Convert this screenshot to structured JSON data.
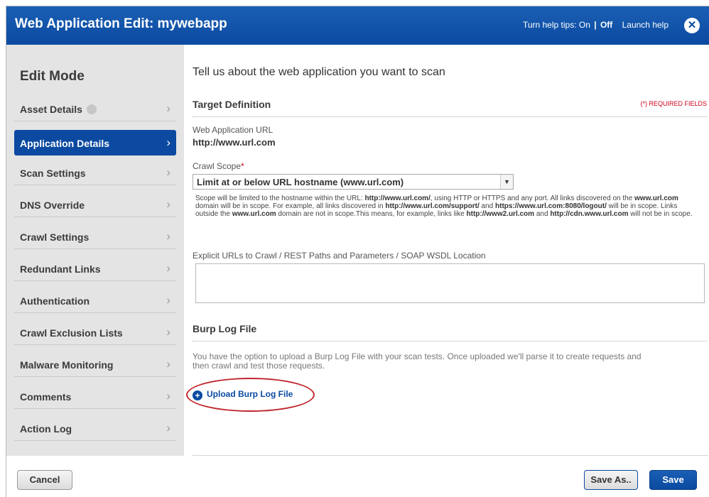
{
  "window": {
    "title": "Web Application Edit: mywebapp",
    "help_prefix": "Turn help tips:",
    "help_on": "On",
    "help_sep": "|",
    "help_off": "Off",
    "launch_help": "Launch help",
    "close_glyph": "✕"
  },
  "sidebar": {
    "heading": "Edit Mode",
    "chevron": "›",
    "items": [
      {
        "label": "Asset Details"
      },
      {
        "label": "Application Details"
      },
      {
        "label": "Scan Settings"
      },
      {
        "label": "DNS Override"
      },
      {
        "label": "Crawl Settings"
      },
      {
        "label": "Redundant Links"
      },
      {
        "label": "Authentication"
      },
      {
        "label": "Crawl Exclusion Lists"
      },
      {
        "label": "Malware Monitoring"
      },
      {
        "label": "Comments"
      },
      {
        "label": "Action Log"
      }
    ]
  },
  "main": {
    "intro": "Tell us about the web application you want to scan",
    "target_definition": "Target Definition",
    "required_note": "(*) REQUIRED FIELDS",
    "url_label": "Web Application URL",
    "url_value": "http://www.url.com",
    "crawl_scope_label": "Crawl Scope",
    "crawl_scope_star": "*",
    "crawl_scope_value": "Limit at or below URL hostname (www.url.com)",
    "note": {
      "p1": "Scope will be limited to the hostname within the URL: ",
      "b1": "http://www.url.com/",
      "p2": ", using HTTP or HTTPS and any port. All links discovered on the ",
      "b2": "www.url.com",
      "p3": " domain will be in scope. For example, all links discovered in ",
      "b3": "http://www.url.com/support/",
      "p4": " and ",
      "b4": "https://www.url.com:8080/logout/",
      "p5": " will be in scope. Links outside the ",
      "b5": "www.url.com",
      "p6": " domain are not in scope.This means, for example, links like ",
      "b6": "http://www2.url.com",
      "p7": " and ",
      "b7": "http://cdn.www.url.com",
      "p8": " will not be in scope."
    },
    "explicit_label": "Explicit URLs to Crawl / REST Paths and Parameters / SOAP WSDL Location",
    "explicit_value": "",
    "burp_title": "Burp Log File",
    "burp_desc": "You have the option to upload a Burp Log File with your scan tests. Once uploaded we'll parse it to create requests and then crawl and test those requests.",
    "upload_label": "Upload Burp Log File"
  },
  "footer": {
    "cancel": "Cancel",
    "save_as": "Save As..",
    "save": "Save"
  }
}
